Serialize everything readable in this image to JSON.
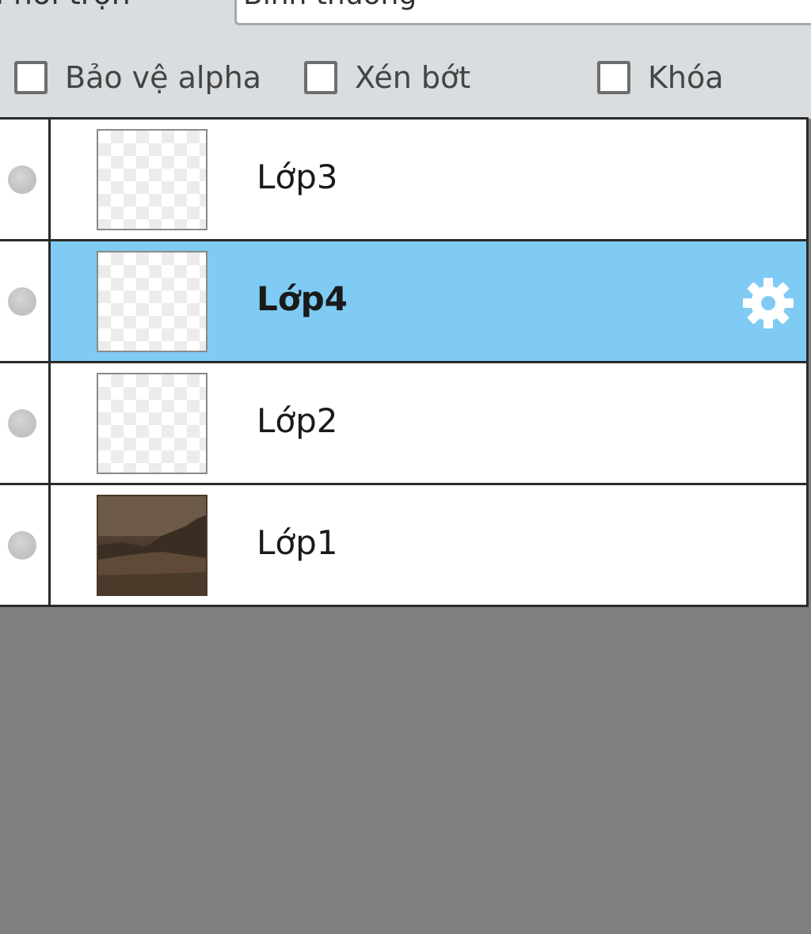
{
  "blend": {
    "label": "Phối trộn",
    "mode": "Bình thường"
  },
  "options": {
    "protect_alpha": "Bảo vệ alpha",
    "clip": "Xén bớt",
    "lock": "Khóa"
  },
  "layers": [
    {
      "name": "Lớp3",
      "thumb": "transparent"
    },
    {
      "name": "Lớp4",
      "thumb": "transparent"
    },
    {
      "name": "Lớp2",
      "thumb": "transparent"
    },
    {
      "name": "Lớp1",
      "thumb": "photo"
    }
  ],
  "colors": {
    "selected_row": "#7fcbf3",
    "panel_bg": "#d9dde0",
    "empty_area": "#7f7f7f"
  },
  "icons": {
    "visibility": "eye-dot-icon",
    "layer_settings": "gear-icon"
  }
}
